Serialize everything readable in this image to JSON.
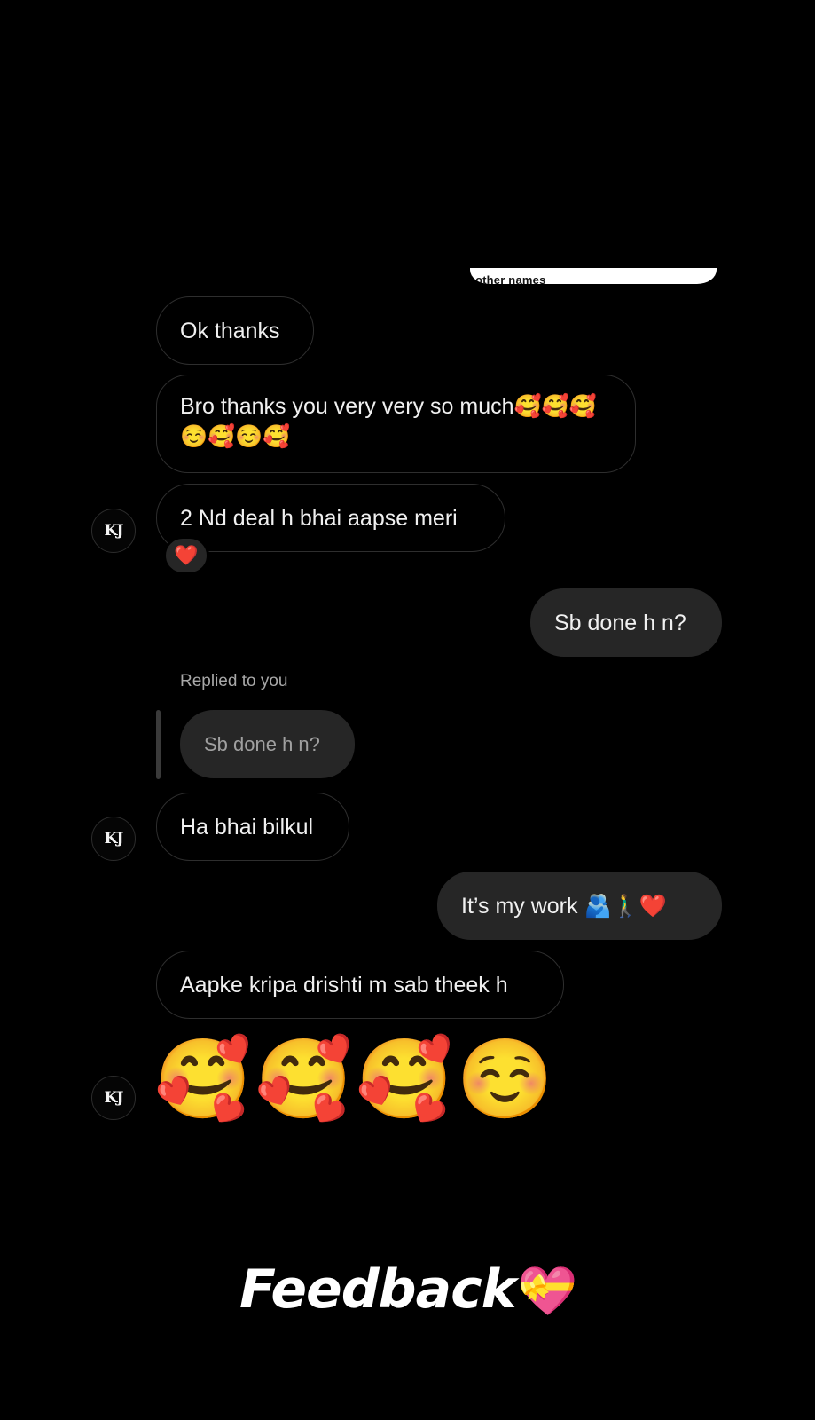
{
  "shared_snippet": {
    "text": "other names"
  },
  "avatar_initials": "KJ",
  "messages": [
    {
      "text": "Ok thanks"
    },
    {
      "text": "Bro thanks you very very so much🥰🥰🥰☺️🥰☺️🥰"
    },
    {
      "text": "2 Nd deal h bhai aapse meri"
    },
    {
      "text": "Sb done h n?"
    },
    {
      "text": "Ha bhai bilkul"
    },
    {
      "text": "It’s my work 🫂🚶‍♂️❤️"
    },
    {
      "text": "Aapke kripa drishti m sab theek h"
    },
    {
      "text": "🥰🥰🥰☺️"
    }
  ],
  "reaction": {
    "emoji": "❤️"
  },
  "reply": {
    "label": "Replied to you",
    "quoted_text": "Sb done h n?"
  },
  "caption": {
    "text": "Feedback",
    "emoji": "💝"
  }
}
